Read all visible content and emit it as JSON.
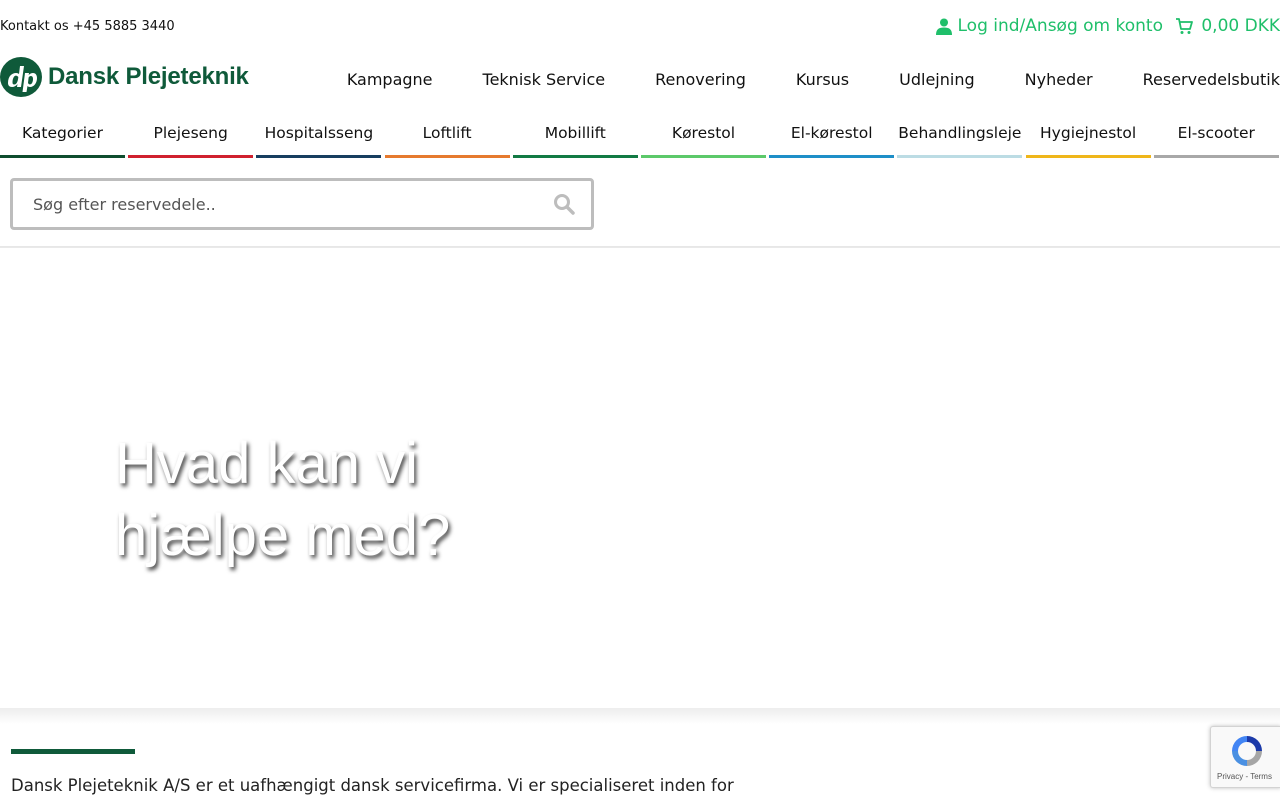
{
  "topbar": {
    "contact": "Kontakt os +45 5885 3440",
    "login": "Log ind/Ansøg om konto",
    "cart_total": "0,00 DKK"
  },
  "logo": {
    "text": "Dansk Plejeteknik"
  },
  "main_nav": [
    "Kampagne",
    "Teknisk Service",
    "Renovering",
    "Kursus",
    "Udlejning",
    "Nyheder",
    "Reservedelsbutik"
  ],
  "categories": [
    {
      "label": "Kategorier",
      "color": "#0f4d2e"
    },
    {
      "label": "Plejeseng",
      "color": "#d0202e"
    },
    {
      "label": "Hospitalsseng",
      "color": "#173e5f"
    },
    {
      "label": "Loftlift",
      "color": "#e67a2e"
    },
    {
      "label": "Mobillift",
      "color": "#127a44"
    },
    {
      "label": "Kørestol",
      "color": "#5cc96a"
    },
    {
      "label": "El-kørestol",
      "color": "#1e8fc8"
    },
    {
      "label": "Behandlingsleje",
      "color": "#bcdce4"
    },
    {
      "label": "Hygiejnestol",
      "color": "#efb61a"
    },
    {
      "label": "El-scooter",
      "color": "#a8a8a8"
    }
  ],
  "search": {
    "placeholder": "Søg efter reservedele.."
  },
  "hero": {
    "title": "Hvad kan vi hjælpe med?"
  },
  "intro": {
    "text": "Dansk Plejeteknik A/S er et uafhængigt dansk servicefirma. Vi er specialiseret inden for"
  },
  "recaptcha": {
    "links": "Privacy - Terms"
  },
  "colors": {
    "accent_green": "#1fbf6a",
    "brand_green": "#0f5a3a"
  }
}
